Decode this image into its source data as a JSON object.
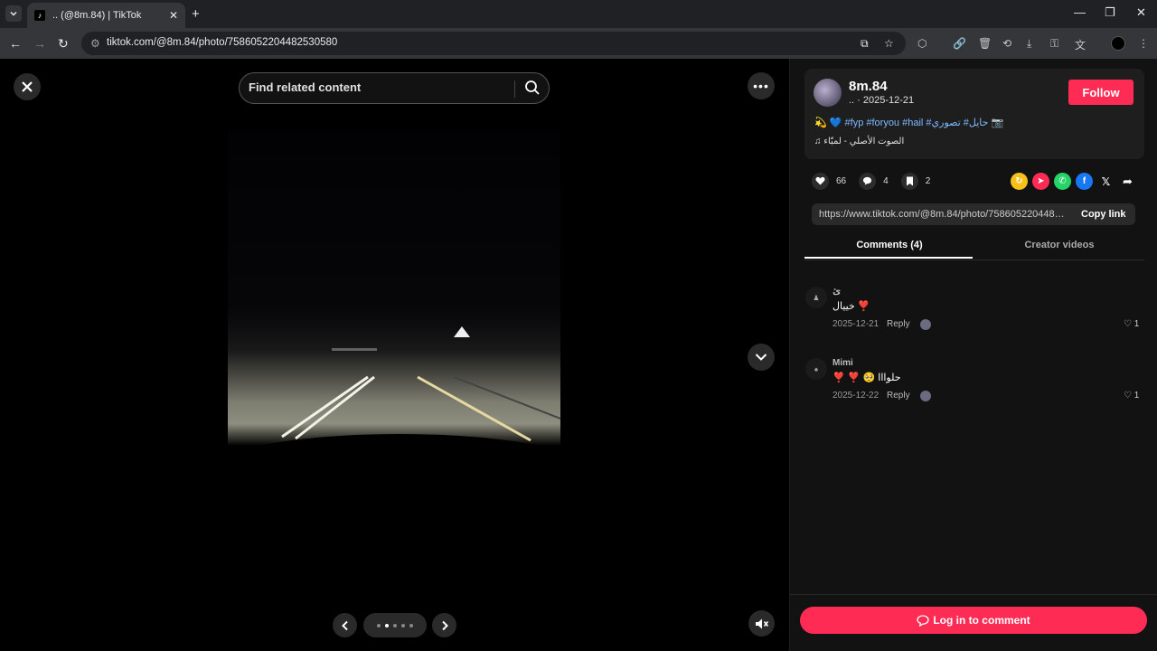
{
  "browser": {
    "tab_title": ".. (@8m.84) | TikTok",
    "url": "tiktok.com/@8m.84/photo/7586052204482530580"
  },
  "viewer": {
    "search_placeholder": "Find related content",
    "slides_total": 5,
    "slide_current": 2
  },
  "post": {
    "username": "8m.84",
    "subline": ".. · 2025-12-21",
    "follow_label": "Follow",
    "caption_prefix": "💫 💙 ",
    "hashtags": "#fyp #foryou #hail #حايل# تصوري 📷",
    "music": "♫   الصوت الأصلي - لمبّاء",
    "likes": "66",
    "comments": "4",
    "saves": "2",
    "share_link": "https://www.tiktok.com/@8m.84/photo/7586052204482530580",
    "copy_label": "Copy link"
  },
  "tabs": {
    "comments": "Comments (4)",
    "creator": "Creator videos"
  },
  "comments": [
    {
      "name": "ئ",
      "text": "خييال ❣️",
      "date": "2025-12-21",
      "reply": "Reply",
      "likes": "1"
    },
    {
      "name": "Mimi",
      "text": "❣️ ❣️ 🥺 حلوااا",
      "date": "2025-12-22",
      "reply": "Reply",
      "likes": "1"
    }
  ],
  "login_label": "Log in to comment",
  "colors": {
    "accent": "#fe2c55",
    "hashtag": "#7db9ff"
  }
}
